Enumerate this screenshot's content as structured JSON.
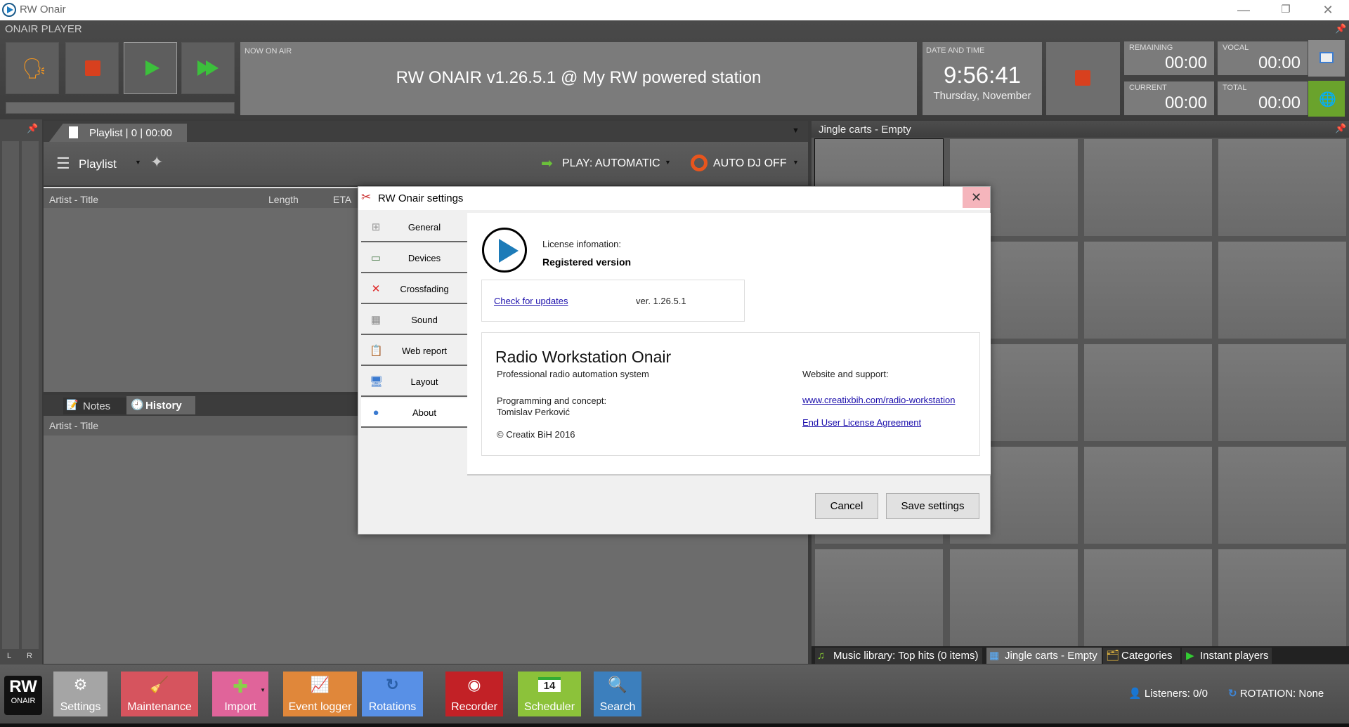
{
  "window": {
    "title": "RW Onair",
    "controls": {
      "minimize": "—",
      "restore": "❐",
      "close": "✕"
    }
  },
  "player": {
    "label": "ONAIR PLAYER",
    "buttons": [
      {
        "name": "voice-button",
        "icon": "voice-speaking-icon"
      },
      {
        "name": "stop-button",
        "icon": "stop-icon"
      },
      {
        "name": "play-button",
        "icon": "play-icon"
      },
      {
        "name": "next-button",
        "icon": "fast-forward-icon"
      }
    ],
    "now_on_air": {
      "label": "NOW ON AIR",
      "title": "RW ONAIR v1.26.5.1 @ My RW powered station"
    },
    "date_time": {
      "label": "DATE AND TIME",
      "time": "9:56:41",
      "date": "Thursday, November"
    },
    "timers": [
      {
        "label": "REMAINING",
        "value": "00:00"
      },
      {
        "label": "VOCAL",
        "value": "00:00"
      },
      {
        "label": "CURRENT",
        "value": "00:00"
      },
      {
        "label": "TOTAL",
        "value": "00:00"
      }
    ]
  },
  "vu": {
    "left": "L",
    "right": "R"
  },
  "playlist": {
    "tab_label": "Playlist | 0 | 00:00",
    "toolbar": {
      "playlist_button": "Playlist",
      "play_mode": "PLAY: AUTOMATIC",
      "auto_dj": "AUTO DJ OFF"
    },
    "columns": [
      "Artist - Title",
      "Length",
      "ETA"
    ]
  },
  "lower_panel": {
    "tabs": [
      {
        "label": "Notes"
      },
      {
        "label": "History",
        "active": true
      }
    ],
    "columns": [
      "Artist - Title"
    ]
  },
  "jingle": {
    "title": "Jingle carts - Empty",
    "bottom_tabs": [
      {
        "label": "Music library: Top hits (0 items)"
      },
      {
        "label": "Jingle carts - Empty",
        "active": true
      },
      {
        "label": "Categories"
      },
      {
        "label": "Instant players"
      }
    ]
  },
  "toolbar": {
    "logo_top": "RW",
    "logo_bottom": "ONAIR",
    "buttons": [
      {
        "label": "Settings",
        "icon": "⚙",
        "color": "#a5a5a5"
      },
      {
        "label": "Maintenance",
        "icon": "🧹",
        "color": "#d6545e"
      },
      {
        "label": "Import",
        "icon": "✚",
        "color": "#e0649a"
      },
      {
        "label": "Event logger",
        "icon": "📈",
        "color": "#e0873a"
      },
      {
        "label": "Rotations",
        "icon": "↻",
        "color": "#5890e6"
      },
      {
        "label": "Recorder",
        "icon": "◉",
        "color": "#c22126"
      },
      {
        "label": "Scheduler",
        "icon": "14",
        "color": "#8cc23a"
      },
      {
        "label": "Search",
        "icon": "🔍",
        "color": "#3c7fbd"
      }
    ],
    "listeners": "Listeners: 0/0",
    "rotation": "ROTATION: None"
  },
  "dialog": {
    "title": "RW Onair settings",
    "close": "✕",
    "nav": [
      {
        "label": "General",
        "icon": "⊞"
      },
      {
        "label": "Devices",
        "icon": "▭"
      },
      {
        "label": "Crossfading",
        "icon": "✕"
      },
      {
        "label": "Sound",
        "icon": "▦"
      },
      {
        "label": "Web report",
        "icon": "📋"
      },
      {
        "label": "Layout",
        "icon": "🖥"
      },
      {
        "label": "About",
        "icon": "●",
        "active": true
      }
    ],
    "license_label": "License infomation:",
    "license_value": "Registered version",
    "check_updates": "Check for updates",
    "version": "ver. 1.26.5.1",
    "about": {
      "product": "Radio Workstation Onair",
      "tagline": "Professional radio automation system",
      "programming_label": "Programming and concept:",
      "author": "Tomislav Perković",
      "copyright": "© Creatix BiH 2016",
      "website_label": "Website and support:",
      "website_link": "www.creatixbih.com/radio-workstation",
      "eula_link": "End User License Agreement"
    },
    "buttons": {
      "cancel": "Cancel",
      "save": "Save settings"
    }
  }
}
